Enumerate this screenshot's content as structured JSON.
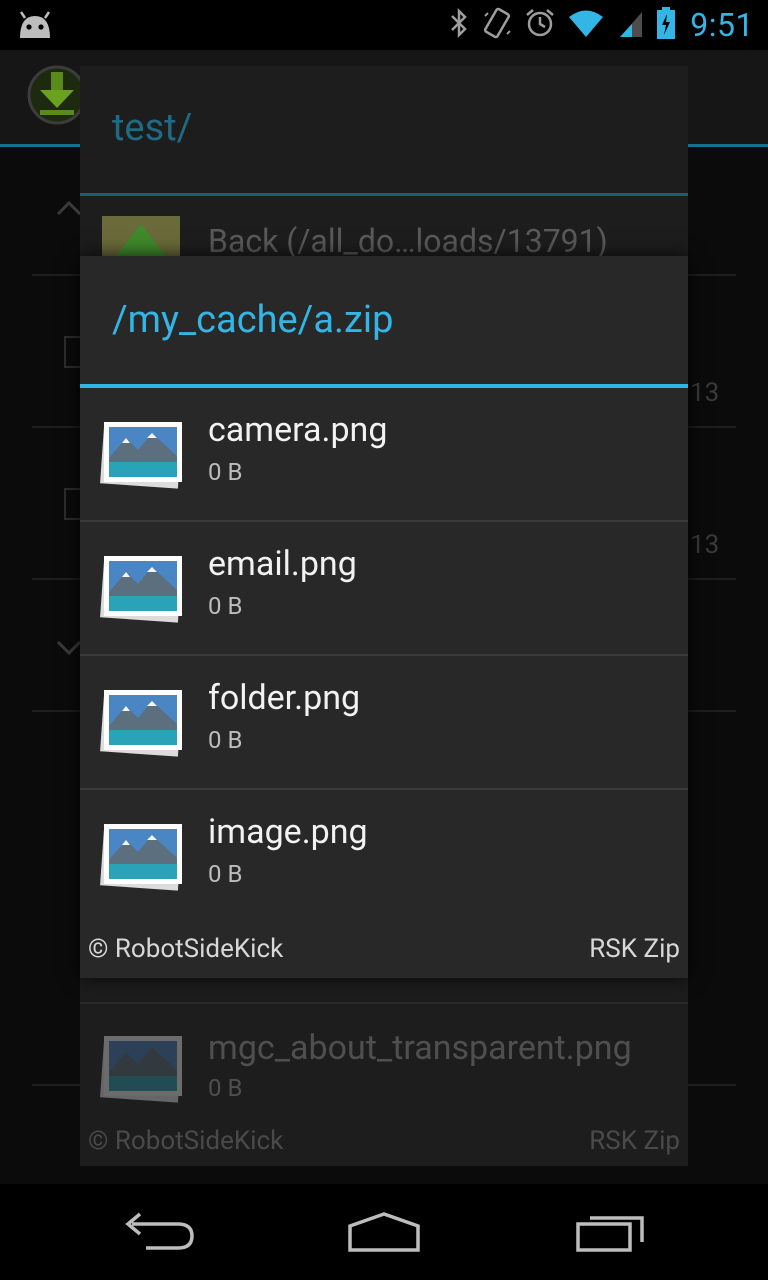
{
  "status_bar": {
    "time": "9:51"
  },
  "background_list": {
    "nums": [
      "13",
      "13"
    ]
  },
  "back_card": {
    "title": "test/",
    "back_label": "Back (/all_do…loads/13791)",
    "item": {
      "name": "mgc_about_transparent.png",
      "size": "0 B"
    },
    "footer_left": "© RobotSideKick",
    "footer_right": "RSK Zip"
  },
  "dialog": {
    "title": "/my_cache/a.zip",
    "items": [
      {
        "name": "camera.png",
        "size": "0 B"
      },
      {
        "name": "email.png",
        "size": "0 B"
      },
      {
        "name": "folder.png",
        "size": "0 B"
      },
      {
        "name": "image.png",
        "size": "0 B"
      }
    ],
    "footer_left": "© RobotSideKick",
    "footer_right": "RSK Zip"
  },
  "icons": {
    "status": [
      "android-icon",
      "bluetooth-icon",
      "vibrate-icon",
      "alarm-icon",
      "wifi-icon",
      "signal-icon",
      "battery-icon"
    ],
    "nav": [
      "back-icon",
      "home-icon",
      "recents-icon"
    ],
    "file": "image-thumbnail-icon"
  },
  "colors": {
    "accent": "#33b5e5",
    "dialog_bg": "#282828"
  }
}
